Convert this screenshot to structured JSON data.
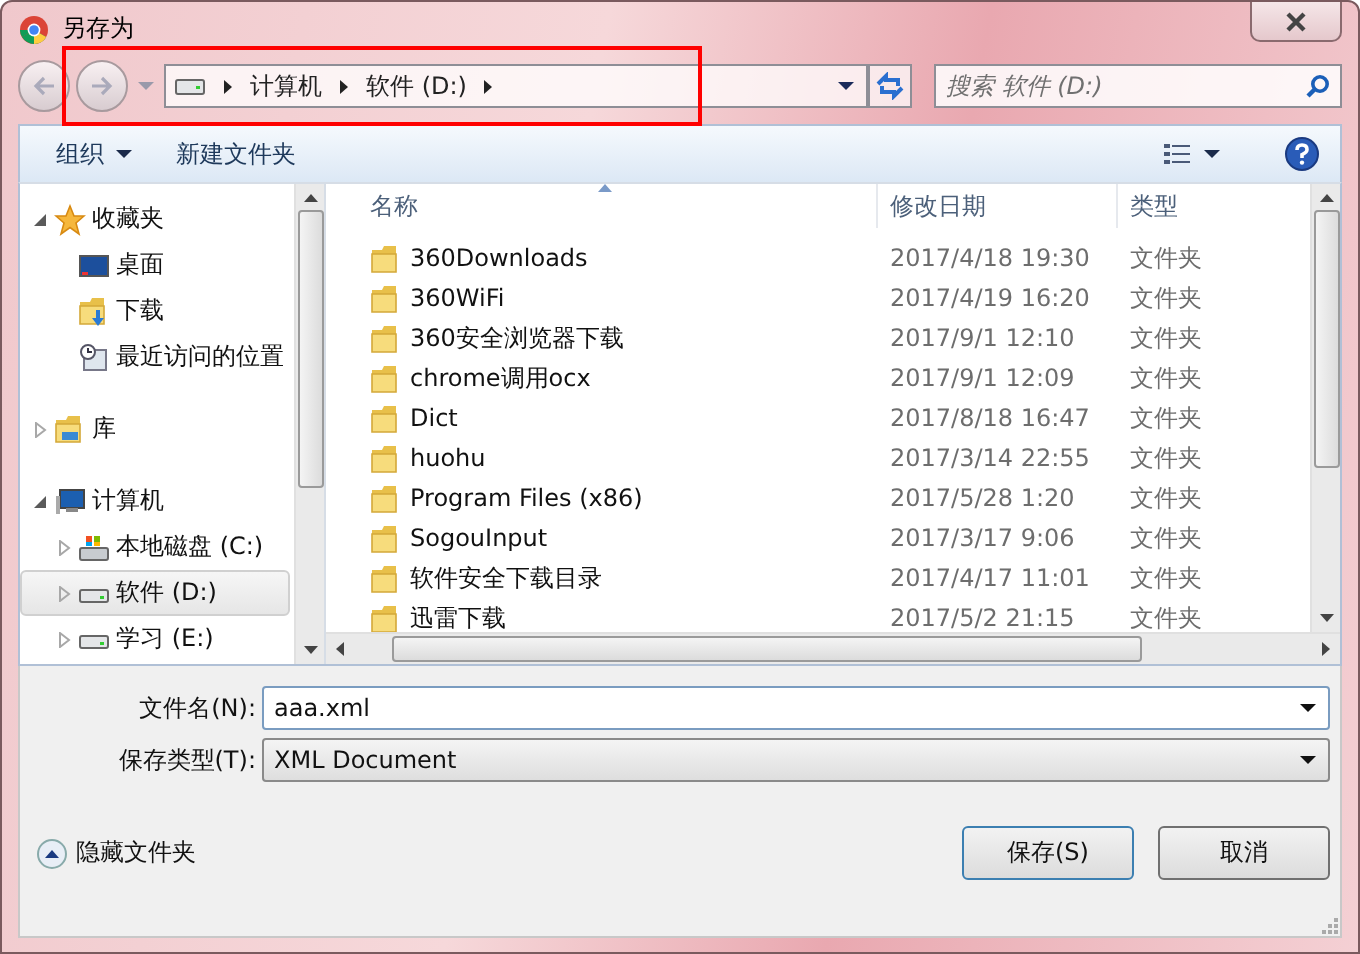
{
  "window": {
    "title": "另存为"
  },
  "address": {
    "segments": [
      "计算机",
      "软件 (D:)"
    ]
  },
  "search": {
    "placeholder": "搜索 软件 (D:)"
  },
  "toolbar": {
    "organize": "组织",
    "new_folder": "新建文件夹"
  },
  "sidebar": {
    "items": [
      {
        "label": "收藏夹",
        "kind": "star",
        "expanded": true,
        "selected": false,
        "children": [
          {
            "label": "桌面",
            "kind": "desktop",
            "selected": false
          },
          {
            "label": "下载",
            "kind": "download",
            "selected": false
          },
          {
            "label": "最近访问的位置",
            "kind": "recent",
            "selected": false
          }
        ]
      },
      {
        "label": "库",
        "kind": "library",
        "expanded": false,
        "selected": false
      },
      {
        "label": "计算机",
        "kind": "computer",
        "expanded": true,
        "selected": false,
        "children": [
          {
            "label": "本地磁盘 (C:)",
            "kind": "system-drive",
            "expanded": false,
            "selected": false
          },
          {
            "label": "软件 (D:)",
            "kind": "drive",
            "expanded": false,
            "selected": true
          },
          {
            "label": "学习 (E:)",
            "kind": "drive",
            "expanded": false,
            "selected": false
          }
        ]
      }
    ]
  },
  "files": {
    "columns": [
      "名称",
      "修改日期",
      "类型"
    ],
    "rows": [
      {
        "name": "360Downloads",
        "modified": "2017/4/18 19:30",
        "type": "文件夹",
        "selected": false
      },
      {
        "name": "360WiFi",
        "modified": "2017/4/19 16:20",
        "type": "文件夹",
        "selected": false
      },
      {
        "name": "360安全浏览器下载",
        "modified": "2017/9/1 12:10",
        "type": "文件夹",
        "selected": false
      },
      {
        "name": "chrome调用ocx",
        "modified": "2017/9/1 12:09",
        "type": "文件夹",
        "selected": false
      },
      {
        "name": "Dict",
        "modified": "2017/8/18 16:47",
        "type": "文件夹",
        "selected": false
      },
      {
        "name": "huohu",
        "modified": "2017/3/14 22:55",
        "type": "文件夹",
        "selected": false
      },
      {
        "name": "Program Files (x86)",
        "modified": "2017/5/28 1:20",
        "type": "文件夹",
        "selected": false
      },
      {
        "name": "SogouInput",
        "modified": "2017/3/17 9:06",
        "type": "文件夹",
        "selected": false
      },
      {
        "name": "软件安全下载目录",
        "modified": "2017/4/17 11:01",
        "type": "文件夹",
        "selected": false
      },
      {
        "name": "迅雷下载",
        "modified": "2017/5/2 21:15",
        "type": "文件夹",
        "selected": false
      }
    ]
  },
  "file_name": {
    "label": "文件名(N):",
    "value": "aaa.xml"
  },
  "file_type": {
    "label": "保存类型(T):",
    "value": "XML Document"
  },
  "hide_folders": "隐藏文件夹",
  "buttons": [
    "保存(S)",
    "取消"
  ]
}
